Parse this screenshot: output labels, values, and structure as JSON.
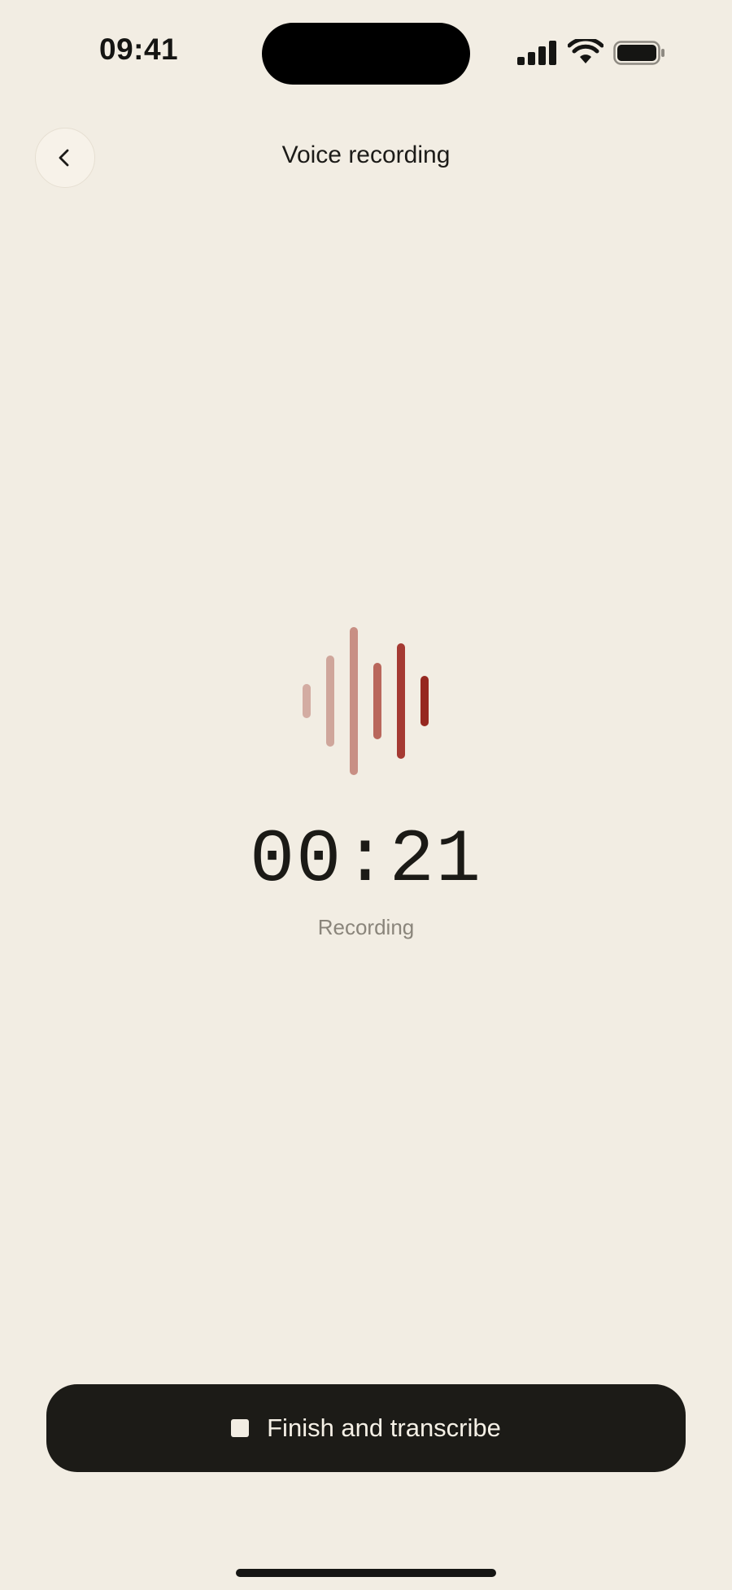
{
  "status_bar": {
    "time": "09:41",
    "icons": [
      "cellular-signal-icon",
      "wifi-icon",
      "battery-icon"
    ]
  },
  "header": {
    "back_icon": "chevron-left-icon",
    "title": "Voice recording"
  },
  "recorder": {
    "waveform_icon": "audio-waveform-icon",
    "waveform_colors": [
      "#d3aca2",
      "#cfa69b",
      "#c88f84",
      "#b9675c",
      "#a53a33",
      "#962820"
    ],
    "timer": "00:21",
    "state": "Recording"
  },
  "actions": {
    "finish_icon": "stop-icon",
    "finish_label": "Finish and transcribe"
  },
  "colors": {
    "background": "#f2ede3",
    "button": "#1c1b17",
    "accent": "#a53a33"
  }
}
